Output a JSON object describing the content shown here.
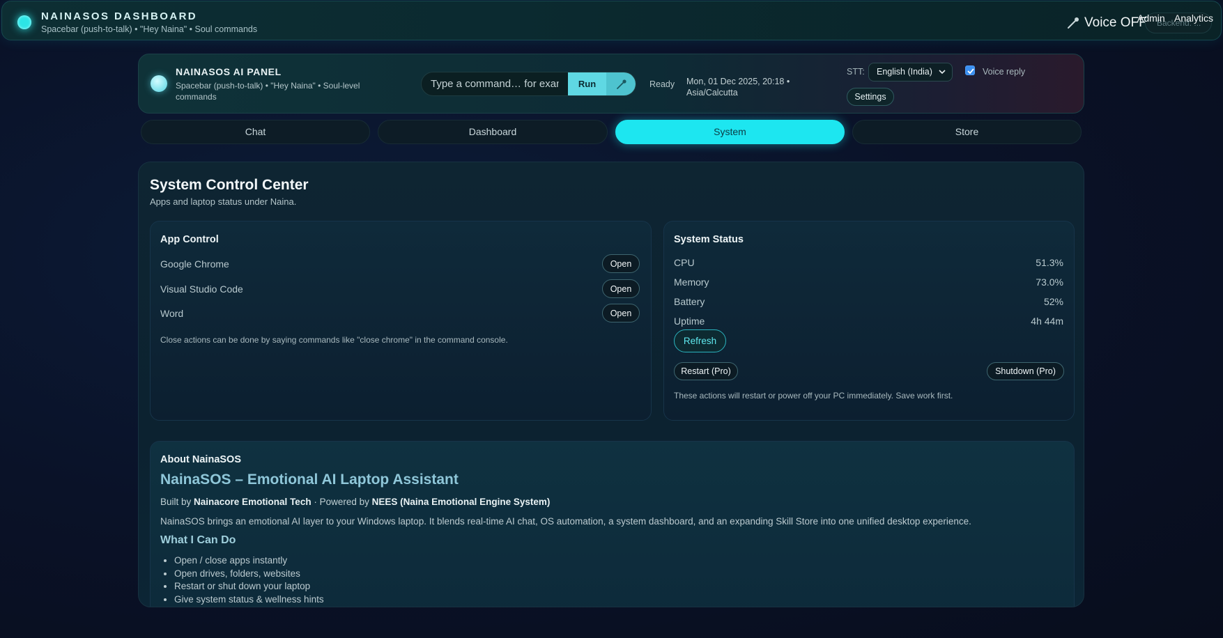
{
  "topbar": {
    "title": "NAINASOS DASHBOARD",
    "subtitle": "Spacebar (push-to-talk) • \"Hey Naina\" • Soul commands",
    "voice_status": "Voice OFF",
    "backend_status": "Backend: ...",
    "admin_link": "Admin",
    "analytics_link": "Analytics"
  },
  "panel": {
    "title": "NAINASOS AI PANEL",
    "subtitle": "Spacebar (push-to-talk) • \"Hey Naina\" • Soul-level commands",
    "command_placeholder": "Type a command… for example",
    "run_label": "Run",
    "status": "Ready",
    "datetime": "Mon, 01 Dec 2025, 20:18 • Asia/Calcutta",
    "stt_label": "STT:",
    "stt_value": "English (India)",
    "voice_reply_label": "Voice reply",
    "voice_reply_checked": true,
    "settings_label": "Settings"
  },
  "tabs": [
    {
      "label": "Chat",
      "active": false
    },
    {
      "label": "Dashboard",
      "active": false
    },
    {
      "label": "System",
      "active": true
    },
    {
      "label": "Store",
      "active": false
    }
  ],
  "system": {
    "title": "System Control Center",
    "subtitle": "Apps and laptop status under Naina."
  },
  "app_control": {
    "title": "App Control",
    "apps": [
      {
        "name": "Google Chrome",
        "action": "Open"
      },
      {
        "name": "Visual Studio Code",
        "action": "Open"
      },
      {
        "name": "Word",
        "action": "Open"
      }
    ],
    "hint": "Close actions can be done by saying commands like \"close chrome\" in the command console."
  },
  "system_status": {
    "title": "System Status",
    "stats": [
      {
        "label": "CPU",
        "value": "51.3%"
      },
      {
        "label": "Memory",
        "value": "73.0%"
      },
      {
        "label": "Battery",
        "value": "52%"
      },
      {
        "label": "Uptime",
        "value": "4h 44m"
      }
    ],
    "refresh_label": "Refresh",
    "restart_label": "Restart (Pro)",
    "shutdown_label": "Shutdown (Pro)",
    "warning": "These actions will restart or power off your PC immediately. Save work first."
  },
  "about": {
    "title": "About NainaSOS",
    "heading": "NainaSOS – Emotional AI Laptop Assistant",
    "built_prefix": "Built by ",
    "built_company": "Nainacore Emotional Tech",
    "built_mid": " · Powered by ",
    "built_engine": "NEES (Naina Emotional Engine System)",
    "description": "NainaSOS brings an emotional AI layer to your Windows laptop. It blends real-time AI chat, OS automation, a system dashboard, and an expanding Skill Store into one unified desktop experience.",
    "can_do_title": "What I Can Do",
    "can_do": [
      "Open / close apps instantly",
      "Open drives, folders, websites",
      "Restart or shut down your laptop",
      "Give system status & wellness hints"
    ]
  },
  "colors": {
    "accent": "#1de6f0",
    "background": "#0a1228",
    "card": "#0f2a3a"
  },
  "icons": {
    "mic": "microphone-icon",
    "chevron": "chevron-down-icon",
    "check": "check-icon"
  }
}
